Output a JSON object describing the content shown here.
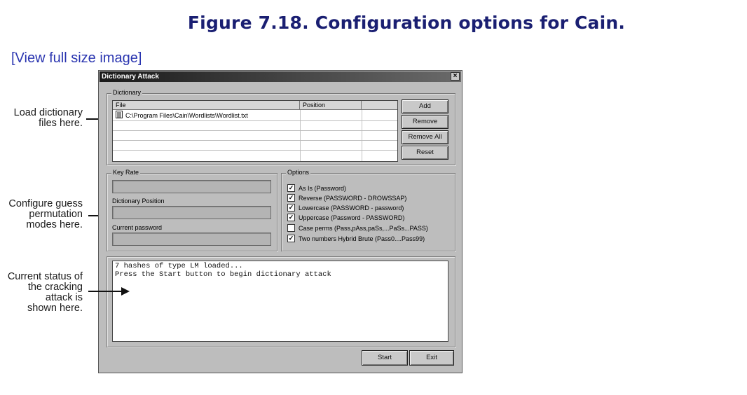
{
  "figure": {
    "title": "Figure 7.18. Configuration options for Cain.",
    "view_link": "[View full size image]"
  },
  "callouts": {
    "load_dictionary": [
      "Load dictionary",
      "files here."
    ],
    "configure_guess": [
      "Configure guess",
      "permutation",
      "modes here."
    ],
    "current_status": [
      "Current status of",
      "the cracking",
      "attack is",
      "shown here."
    ]
  },
  "dialog": {
    "title": "Dictionary Attack",
    "close_glyph": "×",
    "dictionary_group": "Dictionary",
    "columns": [
      "File",
      "Position"
    ],
    "rows": [
      {
        "icon": "file-list-icon",
        "file": "C:\\Program Files\\Cain\\Wordlists\\Wordlist.txt",
        "position": ""
      }
    ],
    "buttons": {
      "add": "Add",
      "remove": "Remove",
      "remove_all": "Remove All",
      "reset": "Reset",
      "start": "Start",
      "exit": "Exit"
    },
    "key_rate_label": "Key Rate",
    "dictionary_position_label": "Dictionary Position",
    "current_password_label": "Current password",
    "options_label": "Options",
    "options": [
      {
        "label": "As Is (Password)",
        "checked": true
      },
      {
        "label": "Reverse (PASSWORD - DROWSSAP)",
        "checked": true
      },
      {
        "label": "Lowercase (PASSWORD - password)",
        "checked": true
      },
      {
        "label": "Uppercase (Password - PASSWORD)",
        "checked": true
      },
      {
        "label": "Case perms (Pass,pAss,paSs,...PaSs...PASS)",
        "checked": false
      },
      {
        "label": "Two numbers Hybrid Brute (Pass0....Pass99)",
        "checked": true
      }
    ],
    "check_glyph": "✓",
    "output_lines": [
      "7 hashes of type LM loaded...",
      "Press the Start button to begin dictionary attack"
    ]
  }
}
